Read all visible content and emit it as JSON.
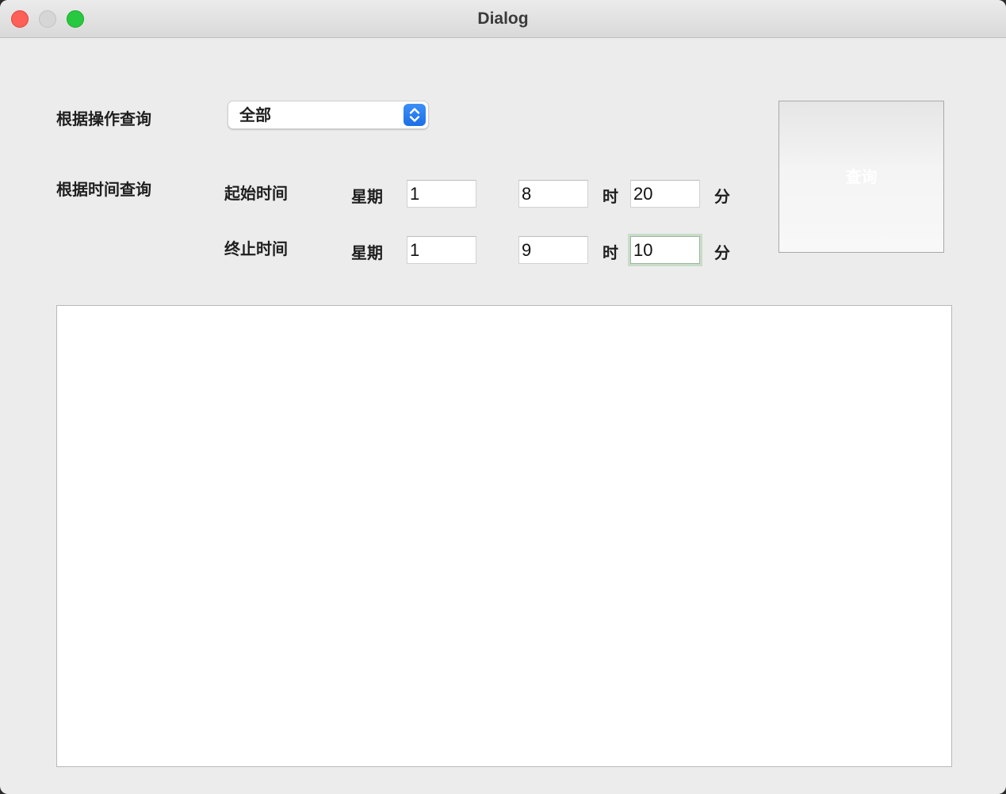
{
  "window": {
    "title": "Dialog"
  },
  "operation_query": {
    "label": "根据操作查询",
    "selected": "全部"
  },
  "time_query": {
    "label": "根据时间查询",
    "start": {
      "label": "起始时间",
      "week_label": "星期",
      "week_value": "1",
      "hour_value": "8",
      "hour_label": "时",
      "minute_value": "20",
      "minute_label": "分"
    },
    "end": {
      "label": "终止时间",
      "week_label": "星期",
      "week_value": "1",
      "hour_value": "9",
      "hour_label": "时",
      "minute_value": "10",
      "minute_label": "分"
    }
  },
  "query_button": {
    "label": "查询"
  },
  "colors": {
    "accent": "#1b6fe6",
    "close": "#fe5f57",
    "zoom": "#28c840"
  }
}
